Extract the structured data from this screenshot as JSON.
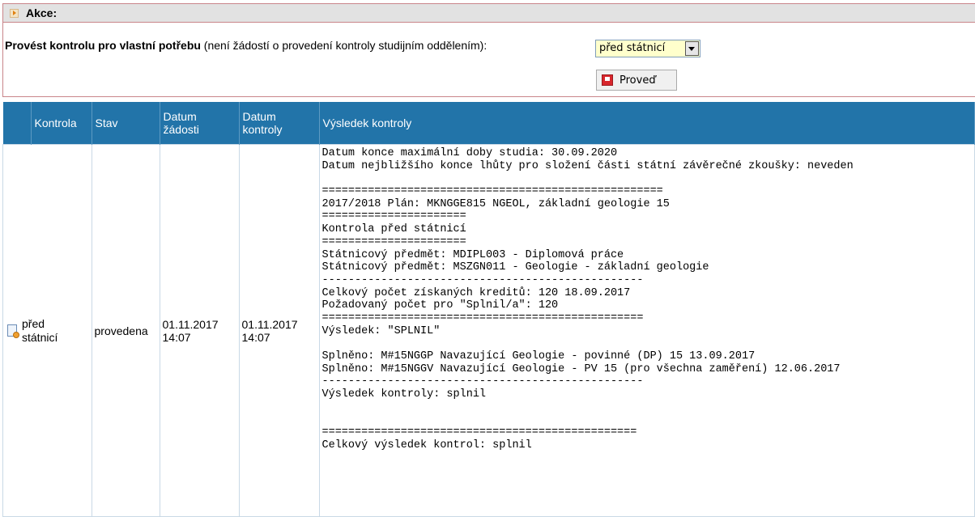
{
  "akce": {
    "title": "Akce:",
    "kontrola_label_bold": "Provést kontrolu pro vlastní potřebu",
    "kontrola_label_rest": " (není žádostí o provedení kontroly studijním oddělením):",
    "select_value": "před státnicí",
    "provest_button": "Proveď"
  },
  "table": {
    "headers": {
      "kontrola": "Kontrola",
      "stav": "Stav",
      "datum_zadosti_1": "Datum",
      "datum_zadosti_2": "žádosti",
      "datum_kontroly_1": "Datum",
      "datum_kontroly_2": "kontroly",
      "vysledek": "Výsledek kontroly"
    },
    "row": {
      "kontrola_1": "před",
      "kontrola_2": "státnicí",
      "stav": "provedena",
      "datum_zadosti_1": "01.11.2017",
      "datum_zadosti_2": "14:07",
      "datum_kontroly_1": "01.11.2017",
      "datum_kontroly_2": "14:07",
      "result_lines": [
        "Datum konce maximální doby studia: 30.09.2020",
        "Datum nejbližšího konce lhůty pro složení části státní závěrečné zkoušky: neveden",
        "",
        "====================================================",
        "2017/2018 Plán: MKNGGE815 NGEOL, základní geologie 15",
        "======================",
        "Kontrola před státnicí",
        "======================",
        "Státnicový předmět: MDIPL003 - Diplomová práce",
        "Státnicový předmět: MSZGN011 - Geologie - základní geologie",
        "-------------------------------------------------",
        "Celkový počet získaných kreditů: 120 18.09.2017",
        "Požadovaný počet pro \"Splnil/a\": 120",
        "=================================================",
        "Výsledek: \"SPLNIL\"",
        "",
        "Splněno: M#15NGGP Navazující Geologie - povinné (DP) 15 13.09.2017",
        "Splněno: M#15NGGV Navazující Geologie - PV 15 (pro všechna zaměření) 12.06.2017",
        "-------------------------------------------------",
        "Výsledek kontroly: splnil",
        "",
        "",
        "================================================",
        "Celkový výsledek kontrol: splnil"
      ]
    }
  }
}
